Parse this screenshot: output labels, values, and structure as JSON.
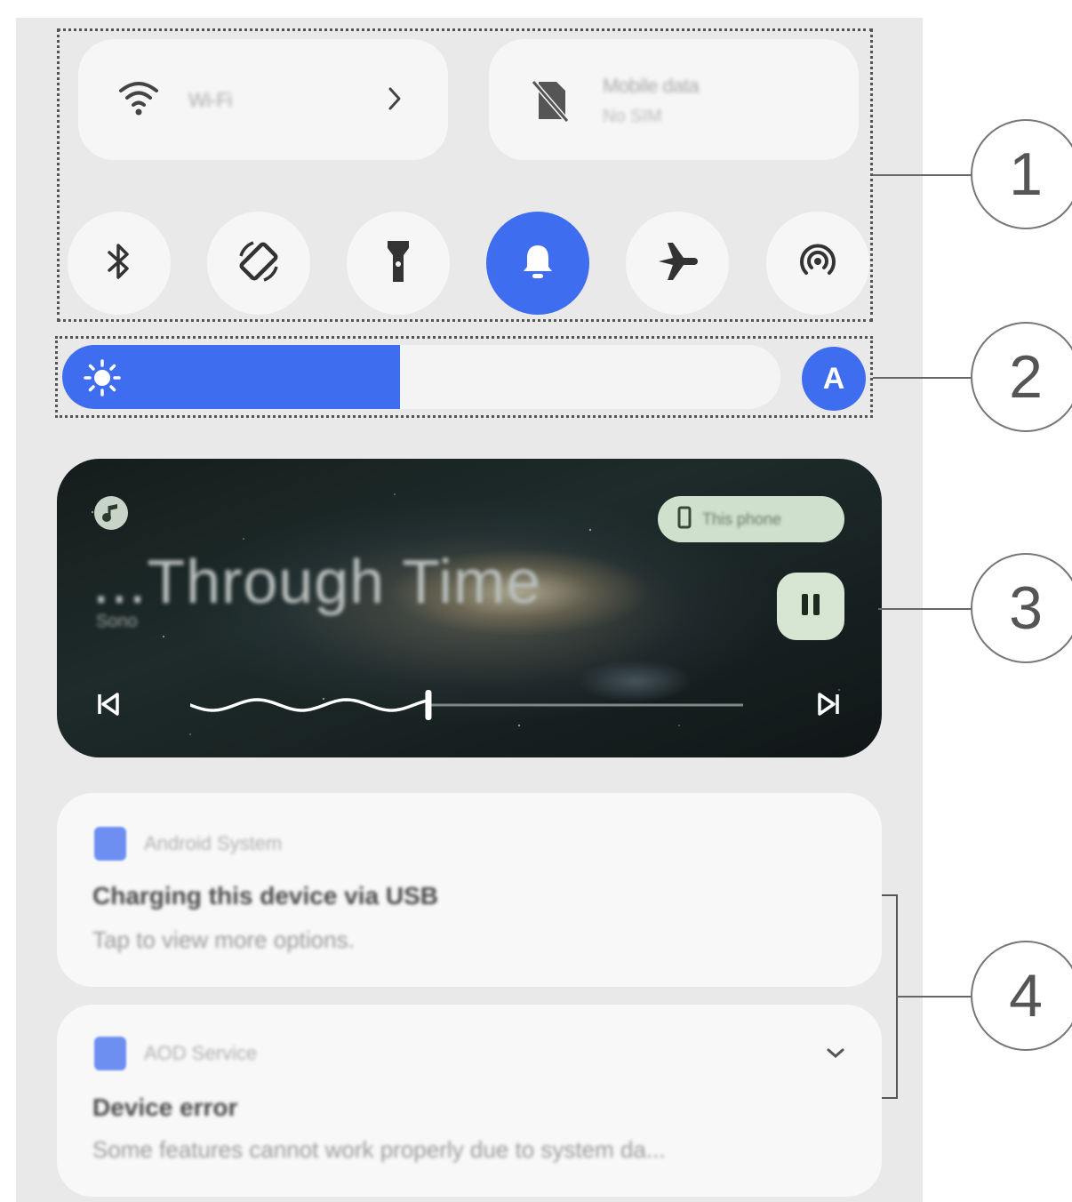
{
  "quick_tiles": {
    "wifi": {
      "label": "Wi-Fi"
    },
    "mobile_data": {
      "label": "Mobile data",
      "sublabel": "No SIM"
    }
  },
  "toggles": [
    {
      "name": "bluetooth",
      "icon": "bluetooth-icon",
      "active": false
    },
    {
      "name": "auto-rotate",
      "icon": "rotate-icon",
      "active": false
    },
    {
      "name": "flashlight",
      "icon": "flashlight-icon",
      "active": false
    },
    {
      "name": "ring",
      "icon": "bell-icon",
      "active": true
    },
    {
      "name": "airplane",
      "icon": "airplane-icon",
      "active": false
    },
    {
      "name": "hotspot",
      "icon": "hotspot-icon",
      "active": false
    }
  ],
  "brightness": {
    "level": 0.47,
    "auto_label": "A"
  },
  "media": {
    "title": "...Through Time",
    "artist": "Sono",
    "output_device": "This phone",
    "progress": 0.43
  },
  "notifications": [
    {
      "app": "Android System",
      "title": "Charging this device via USB",
      "text": "Tap to view more options."
    },
    {
      "app": "AOD Service",
      "title": "Device error",
      "text": "Some features cannot work properly due to system da..."
    }
  ],
  "callouts": [
    "1",
    "2",
    "3",
    "4"
  ],
  "colors": {
    "accent": "#3f6df0",
    "panel": "#e9e9e9",
    "tile": "#f6f6f6",
    "pause_bg": "#d7e6d2"
  }
}
